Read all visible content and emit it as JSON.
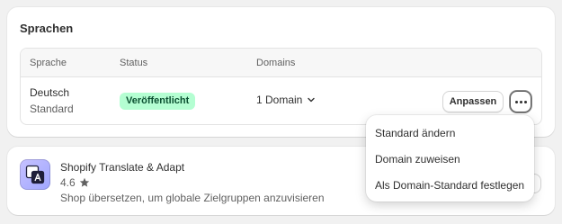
{
  "languages_card": {
    "title": "Sprachen",
    "columns": {
      "language": "Sprache",
      "status": "Status",
      "domains": "Domains"
    },
    "rows": [
      {
        "language": "Deutsch",
        "sublabel": "Standard",
        "status": "Veröffentlicht",
        "domains": "1 Domain",
        "adjust_label": "Anpassen"
      }
    ],
    "status_colors": {
      "badge_bg": "#b4fed2",
      "badge_text": "#0c5132"
    }
  },
  "app_card": {
    "name": "Shopify Translate & Adapt",
    "rating": "4.6",
    "description": "Shop übersetzen, um globale Zielgruppen anzuvisieren",
    "icon": "translate-app-icon"
  },
  "actions_menu": {
    "items": [
      {
        "label": "Standard ändern"
      },
      {
        "label": "Domain zuweisen"
      },
      {
        "label": "Als Domain-Standard festlegen"
      }
    ]
  },
  "icons": {
    "domains_toggle": "chevron-down-icon",
    "more_actions": "more-horizontal-icon",
    "rating": "star-icon"
  }
}
